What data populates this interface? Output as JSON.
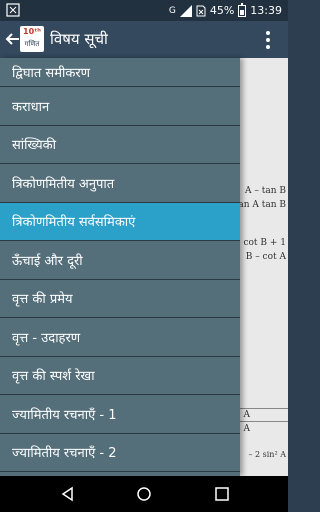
{
  "status_bar": {
    "signal_label": "G",
    "battery_percent": "45%",
    "time": "13:39"
  },
  "app_bar": {
    "logo_top": "10ᵗʰ",
    "logo_bottom": "गणित",
    "title": "विषय सूची"
  },
  "drawer": {
    "items": [
      {
        "label": "द्विघात समीकरण",
        "active": false
      },
      {
        "label": "कराधान",
        "active": false
      },
      {
        "label": "सांख्यिकी",
        "active": false
      },
      {
        "label": "त्रिकोणमितीय अनुपात",
        "active": false
      },
      {
        "label": "त्रिकोणमितीय सर्वसमिकाएं",
        "active": true
      },
      {
        "label": "ऊँचाई और दूरी",
        "active": false
      },
      {
        "label": "वृत्त की प्रमेय",
        "active": false
      },
      {
        "label": "वृत्त - उदाहरण",
        "active": false
      },
      {
        "label": "वृत्त की स्पर्श रेखा",
        "active": false
      },
      {
        "label": "ज्यामितीय रचनाएँ - 1",
        "active": false
      },
      {
        "label": "ज्यामितीय रचनाएँ - 2",
        "active": false
      }
    ]
  },
  "background_content": {
    "line1": "A – tan B",
    "line2": "an A tan B",
    "line3": "cot B + 1",
    "line4": "B – cot A",
    "line5": "A",
    "line6": "A",
    "line7": "– 2 sin² A"
  },
  "colors": {
    "status_bar": "#22313f",
    "app_bar": "#34495e",
    "drawer_item": "#546e7a",
    "drawer_active": "#2ba0c8",
    "nav_bar": "#000000"
  }
}
